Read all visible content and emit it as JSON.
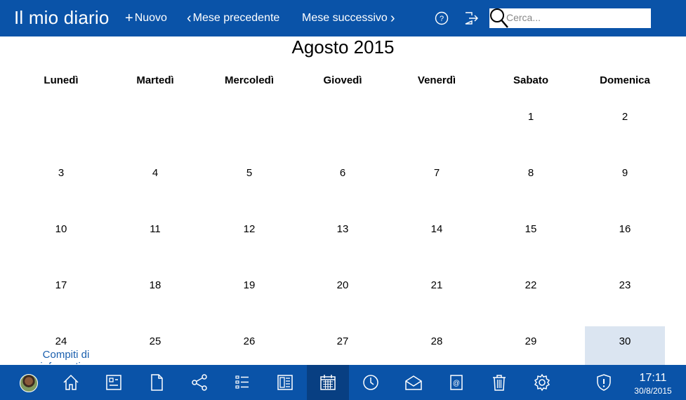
{
  "header": {
    "app_title": "Il mio diario",
    "new_label": "Nuovo",
    "prev_label": "Mese precedente",
    "next_label": "Mese successivo",
    "search_placeholder": "Cerca..."
  },
  "calendar": {
    "month_title": "Agosto 2015",
    "weekdays": [
      "Lunedì",
      "Martedì",
      "Mercoledì",
      "Giovedì",
      "Venerdì",
      "Sabato",
      "Domenica"
    ],
    "weeks": [
      [
        "",
        "",
        "",
        "",
        "",
        "1",
        "2"
      ],
      [
        "3",
        "4",
        "5",
        "6",
        "7",
        "8",
        "9"
      ],
      [
        "10",
        "11",
        "12",
        "13",
        "14",
        "15",
        "16"
      ],
      [
        "17",
        "18",
        "19",
        "20",
        "21",
        "22",
        "23"
      ],
      [
        "24",
        "25",
        "26",
        "27",
        "28",
        "29",
        "30"
      ]
    ],
    "today": "30",
    "event_label": "Compiti di informatica"
  },
  "taskbar": {
    "icons": [
      "user-avatar",
      "home-icon",
      "dashboard-icon",
      "document-icon",
      "share-icon",
      "list-icon",
      "newspaper-icon",
      "calendar-icon",
      "clock-icon",
      "mail-icon",
      "contacts-icon",
      "trash-icon",
      "settings-icon",
      "shield-icon"
    ],
    "active": "calendar-icon",
    "time": "17:11",
    "date": "30/8/2015"
  },
  "colors": {
    "bar_blue": "#0a53a8",
    "active_blue": "#083f82",
    "today_highlight": "#dbe5f1",
    "event_text": "#1a5fae"
  }
}
